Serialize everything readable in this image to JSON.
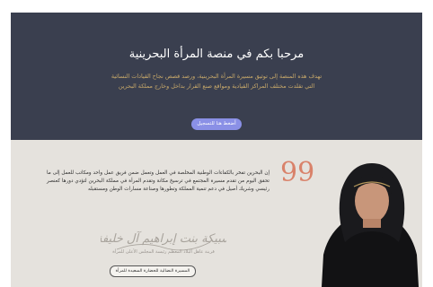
{
  "hero": {
    "title": "مرحبا بكم في منصة المرأة البحرينية",
    "subtitle_line1": "تهدف هذه المنصة إلى توثيق مسيرة المرأة البحرينية، ورصد قصص نجاح القيادات النسائية",
    "subtitle_line2": "التي تقلدت مختلف المراكز القيادية ومواقع صنع القرار بداخل وخارج مملكة البحرين",
    "button_label": "أضغط هنا للتسجيل",
    "colors": {
      "background": "#3a3f4f",
      "subtitle": "#c8a96a",
      "button": "#8a90e6"
    }
  },
  "quote": {
    "mark": "99",
    "text": "إن البحرين تفخر بالكفاءات الوطنية المخلصة في العمل وتعمل ضمن فريق عمل واحد ومكاتب للعمل إلى ما تحقق اليوم من تقدم مسيرة المجتمع في ترسيخ مكانة وتقدم المرأة في مملكة البحرين لتؤدي دورها كعنصر رئيسي وشريك أصيل في دعم تنمية المملكة وتطورها وصناعة مسارات الوطن ومستقبله",
    "signature_line1": "سبيكة بنت إبراهيم آل خليفة",
    "signature_caption": "قرينة عاهل البلاد المعظم رئيسة المجلس الأعلى للمرأة",
    "button_label": "المسيرة النضالية للحضارة السعيدة للمرأة",
    "colors": {
      "background": "#e5e2dd",
      "quote_mark": "#d9826a"
    }
  }
}
